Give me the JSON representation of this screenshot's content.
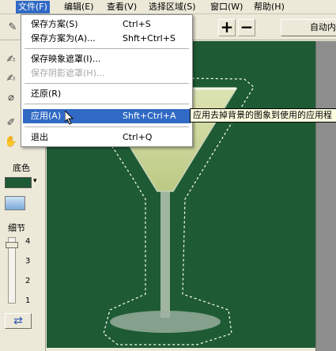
{
  "menubar": {
    "items": [
      {
        "label": "文件(F)"
      },
      {
        "label": "编辑(E)"
      },
      {
        "label": "查看(V)"
      },
      {
        "label": "选择区域(S)"
      },
      {
        "label": "窗口(W)"
      },
      {
        "label": "帮助(H)"
      }
    ]
  },
  "file_menu": {
    "items": [
      {
        "label": "保存方案(S)",
        "shortcut": "Ctrl+S",
        "state": "normal"
      },
      {
        "label": "保存方案为(A)...",
        "shortcut": "Shft+Ctrl+S",
        "state": "normal"
      },
      {
        "label": "保存映象遮罩(I)...",
        "shortcut": "",
        "state": "normal"
      },
      {
        "label": "保存阴影遮罩(H)...",
        "shortcut": "",
        "state": "disabled"
      },
      {
        "label": "还原(R)",
        "shortcut": "",
        "state": "normal"
      },
      {
        "label": "应用(A)",
        "shortcut": "Shft+Ctrl+A",
        "state": "highlighted"
      },
      {
        "label": "退出",
        "shortcut": "Ctrl+Q",
        "state": "normal"
      }
    ]
  },
  "tooltip": {
    "text": "应用去掉背景的图象到使用的应用程"
  },
  "toolbar": {
    "plus_label": "+",
    "minus_label": "−",
    "auto_label": "自动内"
  },
  "left_panel": {
    "bg_color_label": "底色",
    "bg_color": "#1e5b34",
    "detail_label": "细节",
    "ticks": [
      "4",
      "3",
      "2",
      "1"
    ]
  },
  "colors": {
    "canvas_bg": "#1e5b34",
    "highlight": "#316ac5",
    "tooltip_bg": "#ffffe1"
  }
}
